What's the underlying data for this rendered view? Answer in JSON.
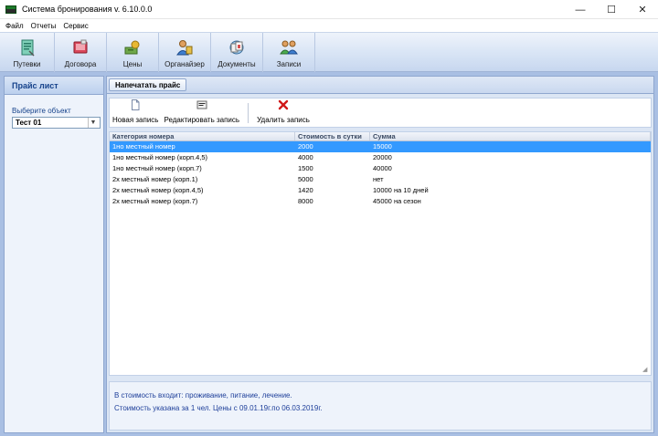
{
  "window": {
    "title": "Система бронирования v. 6.10.0.0",
    "controls": [
      "—",
      "☐",
      "✕"
    ]
  },
  "menu": [
    "Файл",
    "Отчеты",
    "Сервис"
  ],
  "toolbar": [
    {
      "label": "Путевки",
      "icon": "voucher-icon"
    },
    {
      "label": "Договора",
      "icon": "contract-icon"
    },
    {
      "label": "Цены",
      "icon": "prices-icon"
    },
    {
      "label": "Органайзер",
      "icon": "organizer-icon"
    },
    {
      "label": "Документы",
      "icon": "documents-icon"
    },
    {
      "label": "Записи",
      "icon": "records-icon"
    }
  ],
  "left_panel": {
    "title": "Прайс лист",
    "select_label": "Выберите объект",
    "select_value": "Тест 01"
  },
  "right_panel": {
    "print_button": "Напечатать прайс",
    "actions": {
      "new": "Новая запись",
      "edit": "Редактировать запись",
      "delete": "Удалить запись"
    },
    "columns": [
      "Категория номера",
      "Стоимость в сутки",
      "Сумма"
    ],
    "rows": [
      [
        "1но местный номер",
        "2000",
        "15000"
      ],
      [
        "1но местный номер (корп.4,5)",
        "4000",
        "20000"
      ],
      [
        "1но местный номер (корп.7)",
        "1500",
        "40000"
      ],
      [
        "2х местный номер (корп.1)",
        "5000",
        "нет"
      ],
      [
        "2х местный номер (корп.4,5)",
        "1420",
        "10000 на 10 дней"
      ],
      [
        "2х местный номер (корп.7)",
        "8000",
        "45000 на сезон"
      ]
    ],
    "selected_row": 0,
    "info": [
      "В стоимость входит: проживание, питание, лечение.",
      "Стоимость указана за 1 чел. Цены с 09.01.19г.по 06.03.2019г."
    ]
  }
}
